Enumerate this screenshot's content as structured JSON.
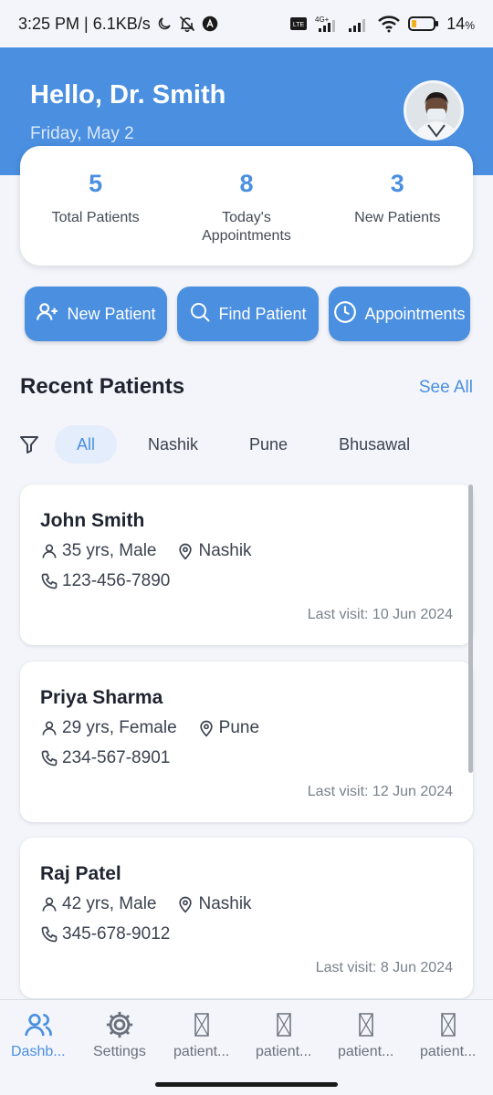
{
  "status_bar": {
    "time_speed": "3:25 PM | 6.1KB/s",
    "network_label_top": "4G+",
    "volte_label": "VoLTE",
    "battery": "14"
  },
  "header": {
    "greeting": "Hello, Dr. Smith",
    "date": "Friday, May 2"
  },
  "stats": [
    {
      "value": "5",
      "label": "Total Patients"
    },
    {
      "value": "8",
      "label": "Today's Appointments"
    },
    {
      "value": "3",
      "label": "New Patients"
    }
  ],
  "actions": [
    {
      "label": "New Patient",
      "icon": "add-user-icon"
    },
    {
      "label": "Find Patient",
      "icon": "search-icon"
    },
    {
      "label": "Appointments",
      "icon": "clock-icon"
    }
  ],
  "recent": {
    "title": "Recent Patients",
    "see_all": "See All"
  },
  "filters": [
    "All",
    "Nashik",
    "Pune",
    "Bhusawal"
  ],
  "patients": [
    {
      "name": "John Smith",
      "age_gender": "35 yrs, Male",
      "location": "Nashik",
      "phone": "123-456-7890",
      "last_visit": "Last visit: 10 Jun 2024"
    },
    {
      "name": "Priya Sharma",
      "age_gender": "29 yrs, Female",
      "location": "Pune",
      "phone": "234-567-8901",
      "last_visit": "Last visit: 12 Jun 2024"
    },
    {
      "name": "Raj Patel",
      "age_gender": "42 yrs, Male",
      "location": "Nashik",
      "phone": "345-678-9012",
      "last_visit": "Last visit: 8 Jun 2024"
    }
  ],
  "bottom_nav": [
    {
      "label": "Dashb...",
      "icon": "users-icon",
      "active": true
    },
    {
      "label": "Settings",
      "icon": "gear-icon",
      "active": false
    },
    {
      "label": "patient...",
      "icon": "broken-image-icon",
      "active": false
    },
    {
      "label": "patient...",
      "icon": "broken-image-icon",
      "active": false
    },
    {
      "label": "patient...",
      "icon": "broken-image-icon",
      "active": false
    },
    {
      "label": "patient...",
      "icon": "broken-image-icon",
      "active": false
    }
  ],
  "colors": {
    "primary": "#4a8fe0",
    "background": "#f3f5fa",
    "card": "#ffffff"
  }
}
